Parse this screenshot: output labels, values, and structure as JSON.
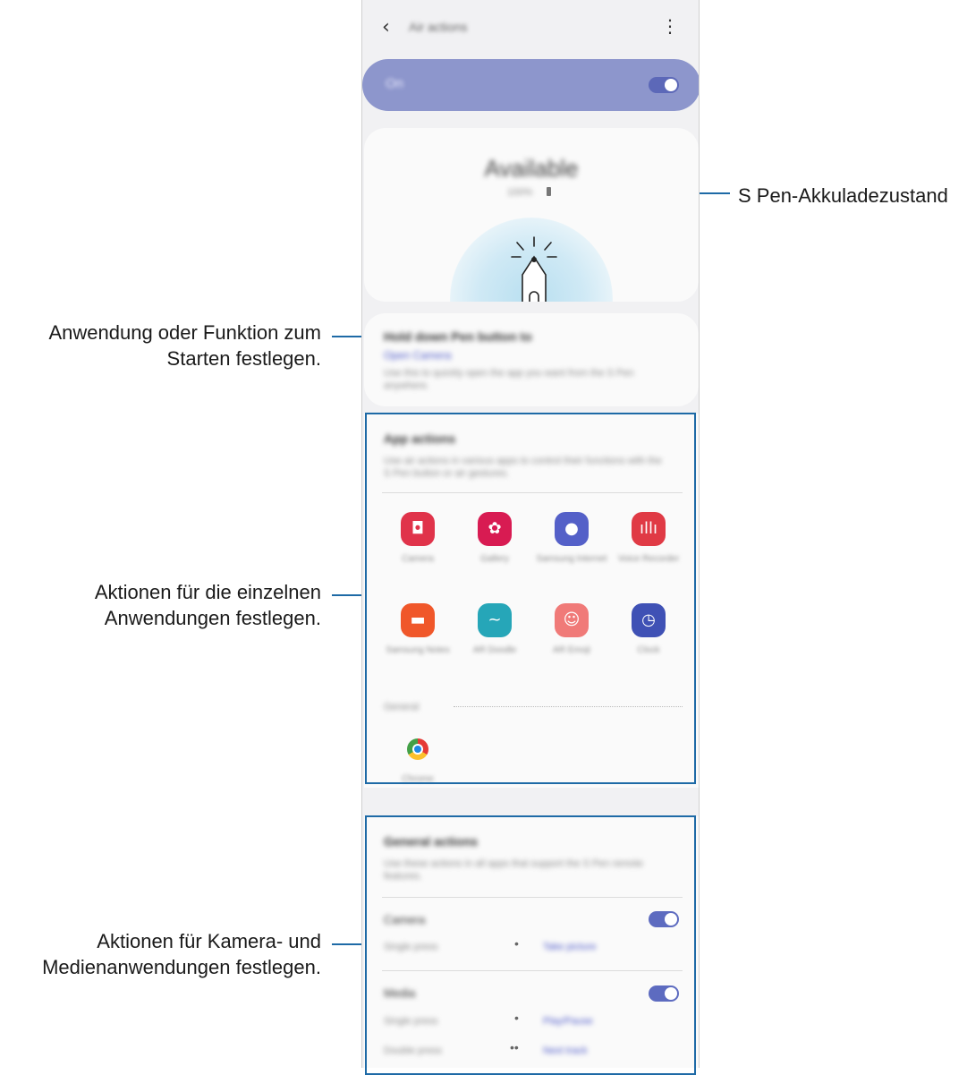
{
  "callouts": {
    "battery": "S Pen-Akkuladezustand",
    "remote_line1": "Anwendung oder Funktion zum",
    "remote_line2": "Starten festlegen.",
    "app_line1": "Aktionen für die einzelnen",
    "app_line2": "Anwendungen festlegen.",
    "media_line1": "Aktionen für Kamera- und",
    "media_line2": "Medienanwendungen festlegen."
  },
  "phone": {
    "header": {
      "title": "Air actions",
      "back_icon": "chevron-left-icon",
      "more_icon": "more-vertical-icon"
    },
    "master": {
      "label": "On",
      "toggle": "on"
    },
    "status": {
      "state": "Available",
      "battery_text": "100%"
    },
    "hold_pen": {
      "title": "Hold down Pen button to",
      "link": "Open Camera",
      "desc": "Use this to quickly open the app you want from the S Pen anywhere."
    },
    "app_actions": {
      "title": "App actions",
      "desc": "Use air actions in various apps to control their functions with the S Pen button or air gestures.",
      "apps": [
        {
          "name": "Camera",
          "color": "#e0334a",
          "glyph": "◘"
        },
        {
          "name": "Gallery",
          "color": "#d81b52",
          "glyph": "✿"
        },
        {
          "name": "Samsung Internet",
          "color": "#5460c8",
          "glyph": "●"
        },
        {
          "name": "Voice Recorder",
          "color": "#e03a45",
          "glyph": "ıllı"
        },
        {
          "name": "Samsung Notes",
          "color": "#f0572a",
          "glyph": "▬"
        },
        {
          "name": "AR Doodle",
          "color": "#26a6b8",
          "glyph": "~"
        },
        {
          "name": "AR Emoji",
          "color": "#f07a78",
          "glyph": "☺"
        },
        {
          "name": "Clock",
          "color": "#3f51b5",
          "glyph": "◷"
        }
      ],
      "general_label": "General",
      "general_apps": [
        {
          "name": "Chrome",
          "glyph": "◉"
        }
      ]
    },
    "general_actions": {
      "title": "General actions",
      "desc": "Use these actions in all apps that support the S Pen remote features.",
      "camera": {
        "title": "Camera",
        "single_label": "Single press",
        "single_value": "Take picture",
        "toggle": "on"
      },
      "media": {
        "title": "Media",
        "single_label": "Single press",
        "single_value": "Play/Pause",
        "double_label": "Double press",
        "double_value": "Next track",
        "toggle": "on"
      }
    }
  }
}
